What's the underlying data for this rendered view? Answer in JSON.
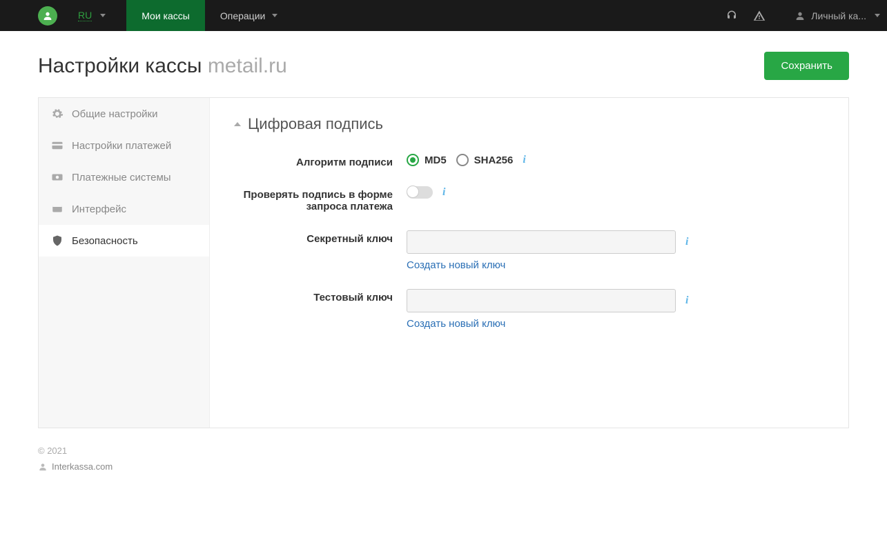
{
  "nav": {
    "lang": "RU",
    "items": [
      "Мои кассы",
      "Операции"
    ],
    "active_index": 0,
    "user_label": "Личный ка..."
  },
  "page": {
    "title": "Настройки кассы",
    "subtitle": "metail.ru",
    "save_label": "Сохранить"
  },
  "sidebar": {
    "items": [
      {
        "icon": "gear-icon",
        "label": "Общие настройки"
      },
      {
        "icon": "card-icon",
        "label": "Настройки платежей"
      },
      {
        "icon": "money-icon",
        "label": "Платежные системы"
      },
      {
        "icon": "window-icon",
        "label": "Интерфейс"
      },
      {
        "icon": "shield-icon",
        "label": "Безопасность"
      }
    ],
    "active_index": 4
  },
  "section": {
    "title": "Цифровая подпись",
    "algo_label": "Алгоритм подписи",
    "algo_options": [
      "MD5",
      "SHA256"
    ],
    "algo_selected": "MD5",
    "verify_label": "Проверять подпись в форме запроса платежа",
    "verify_enabled": false,
    "secret_label": "Секретный ключ",
    "secret_value": "",
    "secret_action": "Создать новый ключ",
    "test_label": "Тестовый ключ",
    "test_value": "",
    "test_action": "Создать новый ключ"
  },
  "footer": {
    "copyright": "© 2021",
    "site": "Interkassa.com"
  }
}
